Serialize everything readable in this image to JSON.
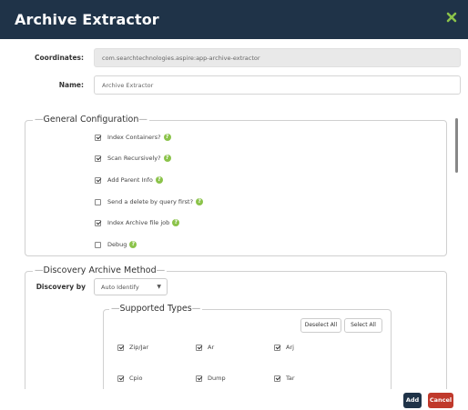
{
  "dialog": {
    "title": "Archive Extractor",
    "close_icon": "close-x-icon"
  },
  "fields": {
    "coordinates_label": "Coordinates:",
    "coordinates_value": "com.searchtechnologies.aspire:app-archive-extractor",
    "name_label": "Name:",
    "name_value": "Archive Extractor"
  },
  "general": {
    "legend": "General Configuration",
    "items": [
      {
        "label": "Index Containers?",
        "checked": true,
        "help": true
      },
      {
        "label": "Scan Recursively?",
        "checked": true,
        "help": true
      },
      {
        "label": "Add Parent Info",
        "checked": true,
        "help": true
      },
      {
        "label": "Send a delete by query first?",
        "checked": false,
        "help": true
      },
      {
        "label": "Index Archive file job",
        "checked": true,
        "help": true
      },
      {
        "label": "Debug",
        "checked": false,
        "help": true
      }
    ]
  },
  "discovery": {
    "legend": "Discovery Archive Method",
    "discovery_by_label": "Discovery by",
    "discovery_by_value": "Auto Identify"
  },
  "supported_types": {
    "legend": "Supported Types",
    "deselect_all": "Deselect All",
    "select_all": "Select All",
    "items": [
      {
        "label": "Zip/Jar",
        "checked": true
      },
      {
        "label": "Ar",
        "checked": true
      },
      {
        "label": "Arj",
        "checked": true
      },
      {
        "label": "Cpio",
        "checked": true
      },
      {
        "label": "Dump",
        "checked": true
      },
      {
        "label": "Tar",
        "checked": true
      }
    ]
  },
  "footer": {
    "add_label": "Add",
    "cancel_label": "Cancel"
  },
  "colors": {
    "header": "#1f3348",
    "accent_green": "#8bc34a",
    "cancel_red": "#c0392b"
  }
}
